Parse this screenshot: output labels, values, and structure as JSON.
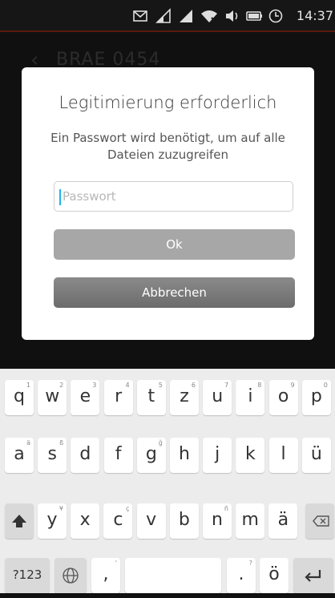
{
  "status_bar": {
    "time": "14:37",
    "icons": [
      "message-icon",
      "signal-icon",
      "signal-icon",
      "wifi-icon",
      "volume-icon",
      "battery-icon",
      "alarm-icon"
    ]
  },
  "background": {
    "title": "BRAE 0454"
  },
  "dialog": {
    "title": "Legitimierung erforderlich",
    "message": "Ein Passwort wird benötigt, um auf alle Dateien zuzugreifen",
    "password_placeholder": "Passwort",
    "ok_label": "Ok",
    "cancel_label": "Abbrechen"
  },
  "keyboard": {
    "row1": [
      {
        "k": "q",
        "s": "1"
      },
      {
        "k": "w",
        "s": "2"
      },
      {
        "k": "e",
        "s": "3"
      },
      {
        "k": "r",
        "s": "4"
      },
      {
        "k": "t",
        "s": "5"
      },
      {
        "k": "z",
        "s": "6"
      },
      {
        "k": "u",
        "s": "7"
      },
      {
        "k": "i",
        "s": "8"
      },
      {
        "k": "o",
        "s": "9"
      },
      {
        "k": "p",
        "s": "0"
      }
    ],
    "row2": [
      {
        "k": "a",
        "s": "ä"
      },
      {
        "k": "s",
        "s": "ß"
      },
      {
        "k": "d",
        "s": ""
      },
      {
        "k": "f",
        "s": ""
      },
      {
        "k": "g",
        "s": "ğ"
      },
      {
        "k": "h",
        "s": ""
      },
      {
        "k": "j",
        "s": ""
      },
      {
        "k": "k",
        "s": ""
      },
      {
        "k": "l",
        "s": ""
      },
      {
        "k": "ü",
        "s": ""
      }
    ],
    "row3": [
      {
        "k": "y",
        "s": "¥"
      },
      {
        "k": "x",
        "s": ""
      },
      {
        "k": "c",
        "s": "ç"
      },
      {
        "k": "v",
        "s": ""
      },
      {
        "k": "b",
        "s": ""
      },
      {
        "k": "n",
        "s": "ñ"
      },
      {
        "k": "m",
        "s": ""
      },
      {
        "k": "ä",
        "s": ""
      }
    ],
    "symbols_label": "?123",
    "comma": ",",
    "comma_sup": "'",
    "period": ".",
    "period_sup": "?",
    "o_umlaut": "ö"
  }
}
